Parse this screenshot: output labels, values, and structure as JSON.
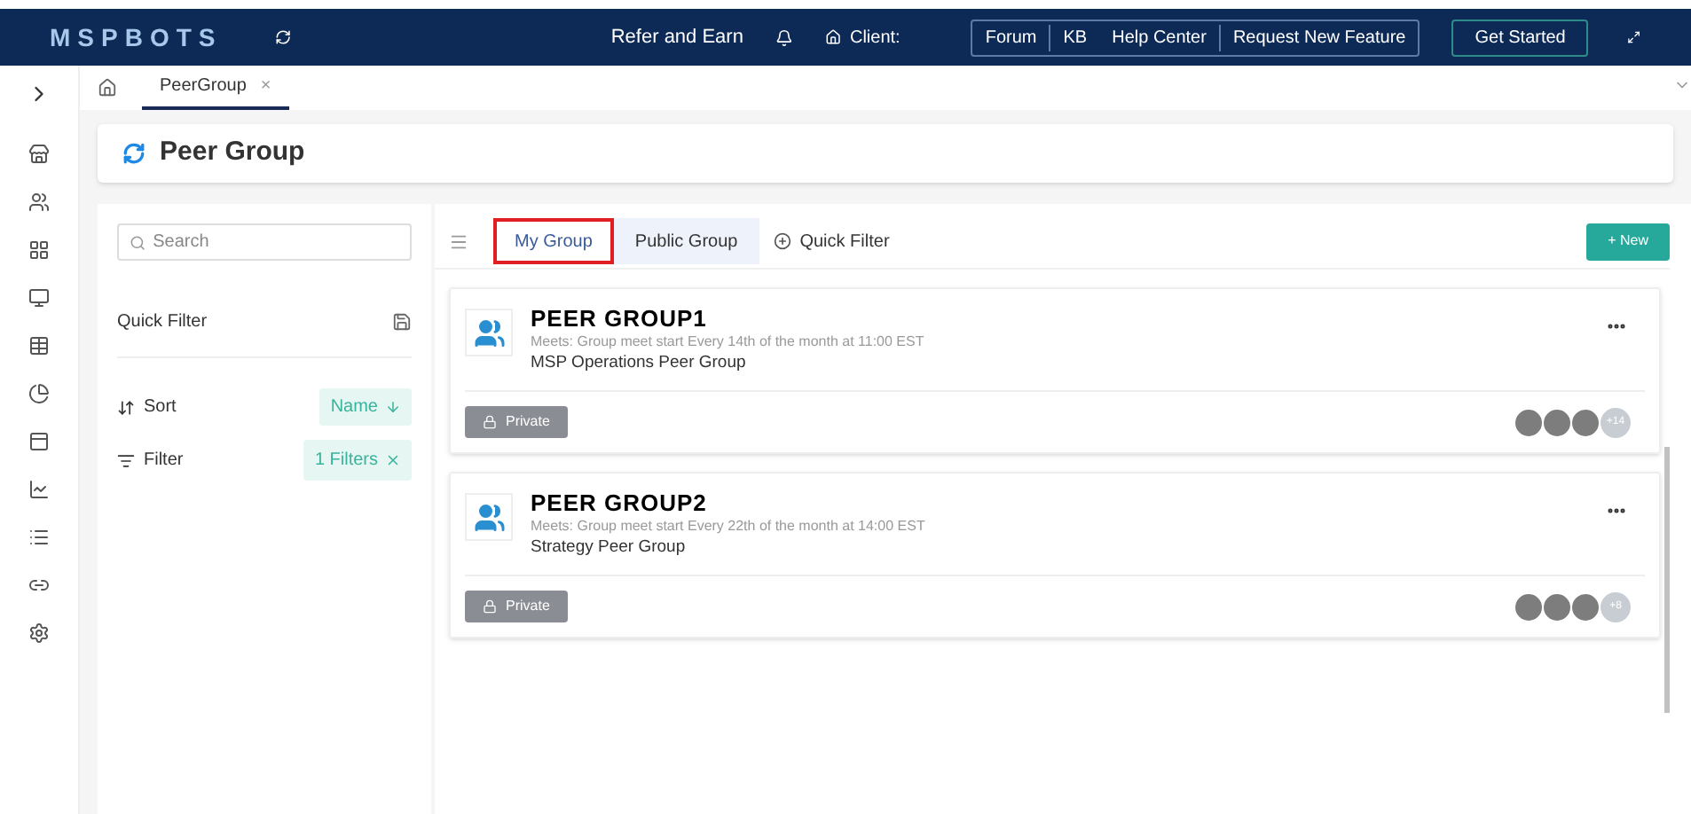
{
  "navbar": {
    "logo": "MSPBOTS",
    "refer": "Refer and Earn",
    "client": "Client:",
    "links": [
      "Forum",
      "KB",
      "Help Center",
      "Request New Feature"
    ],
    "get_started": "Get Started"
  },
  "tabs_bar": {
    "tabs": [
      {
        "label": "PeerGroup",
        "selected": true,
        "close": "×"
      }
    ]
  },
  "page": {
    "title": "Peer Group"
  },
  "left_panel": {
    "search": {
      "placeholder": "Search"
    },
    "quick_filter": "Quick Filter",
    "sort": {
      "label": "Sort",
      "value": "Name"
    },
    "filter": {
      "label": "Filter",
      "value": "1 Filters"
    }
  },
  "view_tabs": [
    {
      "label": "My Group",
      "selected": true,
      "annotated": true
    },
    {
      "label": "Public Group",
      "selected": false,
      "annotated": false
    }
  ],
  "quick_filter": "Quick Filter",
  "new_button": "+ New",
  "groups": [
    {
      "name": "PEER GROUP1",
      "meets": "Meets: Group meet start Every 14th of the month at 11:00 EST",
      "description": "MSP Operations Peer Group",
      "privacy": "Private",
      "more": "+14"
    },
    {
      "name": "PEER GROUP2",
      "meets": "Meets: Group meet start Every 22th of the month at 14:00 EST",
      "description": "Strategy Peer Group",
      "privacy": "Private",
      "more": "+8"
    }
  ]
}
